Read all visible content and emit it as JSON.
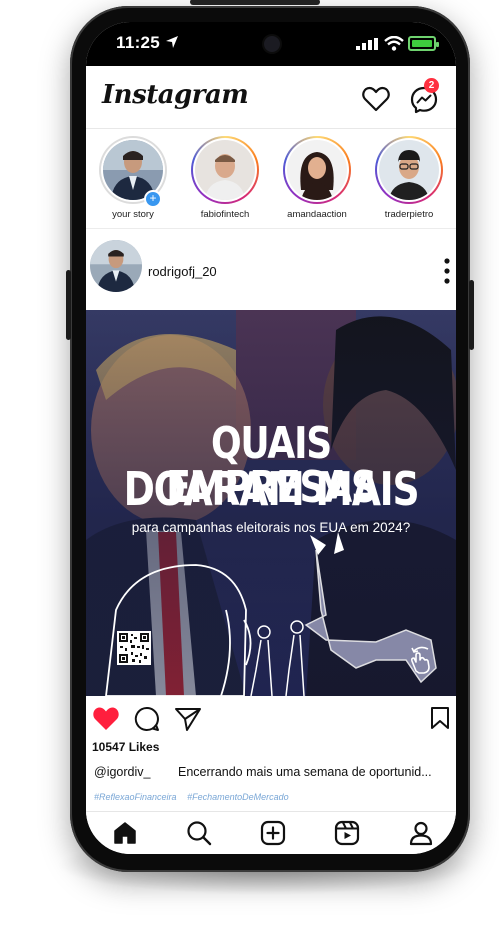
{
  "status_bar": {
    "time": "11:25"
  },
  "header": {
    "logo": "Instagram",
    "notification_count": "2"
  },
  "stories": [
    {
      "label": "your story"
    },
    {
      "label": "fabiofintech"
    },
    {
      "label": "amandaaction"
    },
    {
      "label": "traderpietro"
    }
  ],
  "post": {
    "username": "rodrigofj_20",
    "image": {
      "headline_line1": "QUAIS EMPRESAS",
      "headline_line2": "DOARAM MAIS",
      "subline": "para campanhas eleitorais nos EUA em 2024?"
    },
    "likes": "10547 Likes",
    "caption_user": "@igordiv_",
    "caption_text": "Encerrando mais uma semana de oportunid...",
    "hashtag1": "#ReflexaoFinanceira",
    "hashtag2": "#FechamentoDeMercado"
  },
  "colors": {
    "like_red": "#ff1f3d",
    "badge_red": "#ff3040",
    "link_blue": "#7aa7d6"
  },
  "icons": [
    "heart-icon",
    "messenger-icon",
    "like-icon",
    "comment-icon",
    "share-icon",
    "bookmark-icon",
    "home-icon",
    "search-icon",
    "create-icon",
    "reels-icon",
    "profile-icon"
  ]
}
